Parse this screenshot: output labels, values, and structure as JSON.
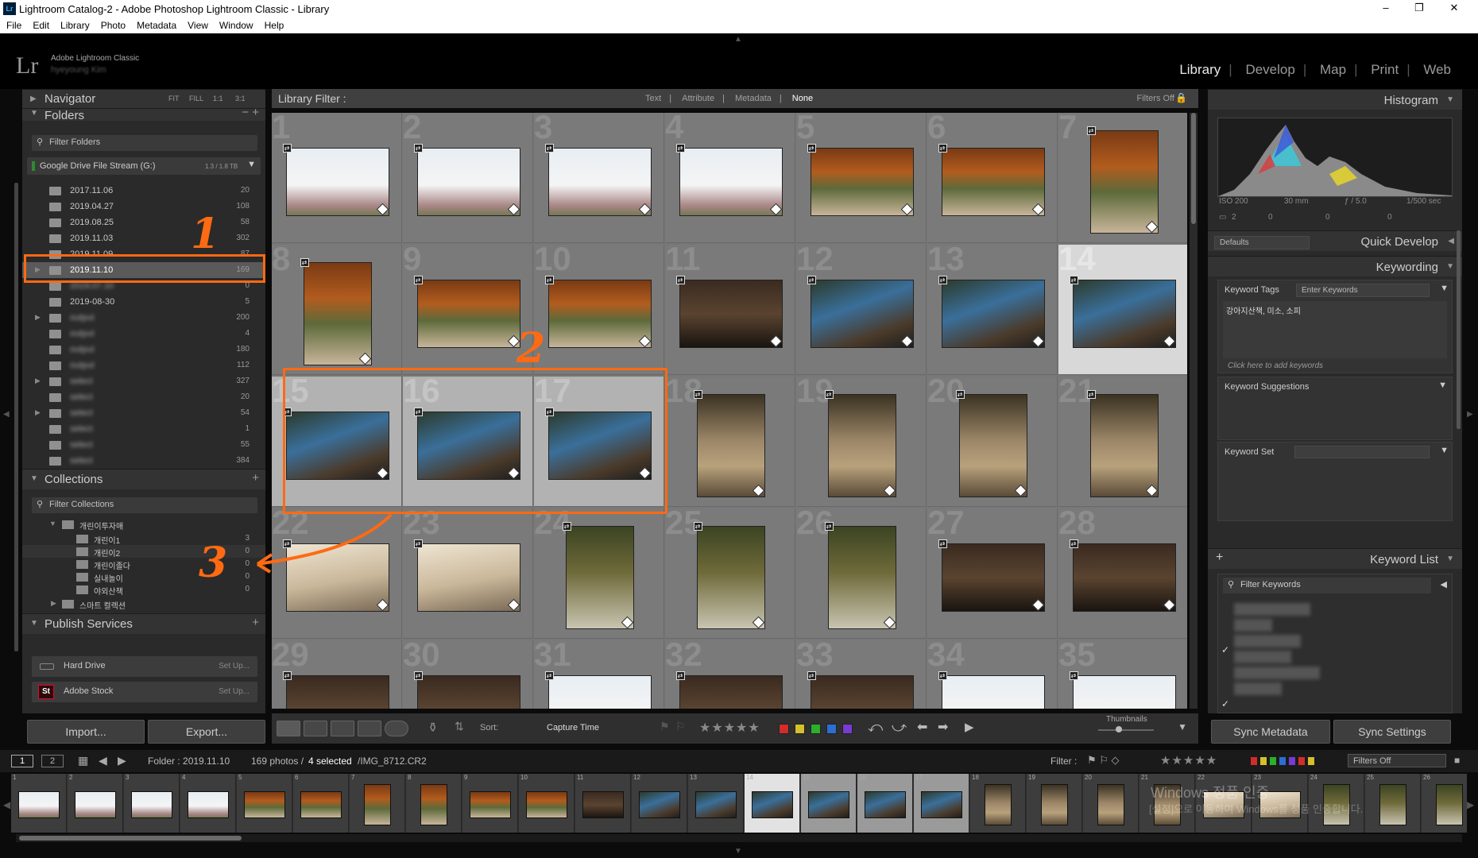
{
  "window": {
    "title": "Lightroom Catalog-2 - Adobe Photoshop Lightroom Classic - Library",
    "app_icon": "Lr",
    "min": "–",
    "max": "❐",
    "close": "✕"
  },
  "menu": [
    "File",
    "Edit",
    "Library",
    "Photo",
    "Metadata",
    "View",
    "Window",
    "Help"
  ],
  "identity": {
    "logo": "Lr",
    "product": "Adobe Lightroom Classic",
    "user": "hyeyoung Kim"
  },
  "modules": [
    "Library",
    "Develop",
    "Map",
    "Print",
    "Web"
  ],
  "active_module": "Library",
  "navigator": {
    "title": "Navigator",
    "zoom": [
      "FIT",
      "FILL",
      "1:1",
      "3:1"
    ]
  },
  "folders": {
    "title": "Folders",
    "filter": "Filter Folders",
    "volume": {
      "name": "Google Drive File Stream (G:)",
      "space": "1.3 / 1.8 TB"
    },
    "items": [
      {
        "name": "2017.11.06",
        "count": "20"
      },
      {
        "name": "2019.04.27",
        "count": "108"
      },
      {
        "name": "2019.08.25",
        "count": "58"
      },
      {
        "name": "2019.11.03",
        "count": "302"
      },
      {
        "name": "2019.11.09",
        "count": "87"
      },
      {
        "name": "2019.11.10",
        "count": "169"
      },
      {
        "name": "2019.07.10",
        "count": "0"
      },
      {
        "name": "2019-08-30",
        "count": "5"
      },
      {
        "name": "output",
        "count": "200"
      },
      {
        "name": "output",
        "count": "4"
      },
      {
        "name": "output",
        "count": "180"
      },
      {
        "name": "output",
        "count": "112"
      },
      {
        "name": "select",
        "count": "327"
      },
      {
        "name": "select",
        "count": "20"
      },
      {
        "name": "select",
        "count": "54"
      },
      {
        "name": "select",
        "count": "1"
      },
      {
        "name": "select",
        "count": "55"
      },
      {
        "name": "select",
        "count": "384"
      }
    ]
  },
  "collections": {
    "title": "Collections",
    "filter": "Filter Collections",
    "set": "개린이투자매",
    "items": [
      {
        "name": "개린이1",
        "count": "3"
      },
      {
        "name": "개린이2",
        "count": "0"
      },
      {
        "name": "개린이졸다",
        "count": "0"
      },
      {
        "name": "실내놀이",
        "count": "0"
      },
      {
        "name": "야외산책",
        "count": "0"
      }
    ],
    "smart": "스마트 컬렉션"
  },
  "publish": {
    "title": "Publish Services",
    "services": [
      {
        "name": "Hard Drive",
        "action": "Set Up..."
      },
      {
        "name": "Adobe Stock",
        "action": "Set Up..."
      }
    ]
  },
  "buttons": {
    "import": "Import...",
    "export": "Export...",
    "sync_metadata": "Sync Metadata",
    "sync_settings": "Sync Settings"
  },
  "library_filter": {
    "label": "Library Filter :",
    "options": [
      "Text",
      "Attribute",
      "Metadata",
      "None"
    ],
    "active": "None",
    "preset": "Filters Off"
  },
  "grid": {
    "cells": [
      {
        "n": "1",
        "kind": "sky",
        "o": "l"
      },
      {
        "n": "2",
        "kind": "sky",
        "o": "l"
      },
      {
        "n": "3",
        "kind": "sky",
        "o": "l"
      },
      {
        "n": "4",
        "kind": "sky",
        "o": "l"
      },
      {
        "n": "5",
        "kind": "tree",
        "o": "l"
      },
      {
        "n": "6",
        "kind": "tree",
        "o": "l"
      },
      {
        "n": "7",
        "kind": "tree",
        "o": "p"
      },
      {
        "n": "8",
        "kind": "tree",
        "o": "p"
      },
      {
        "n": "9",
        "kind": "tree",
        "o": "l"
      },
      {
        "n": "10",
        "kind": "tree",
        "o": "l"
      },
      {
        "n": "11",
        "kind": "dark",
        "o": "l"
      },
      {
        "n": "12",
        "kind": "pup",
        "o": "l"
      },
      {
        "n": "13",
        "kind": "pup",
        "o": "l"
      },
      {
        "n": "14",
        "kind": "pup",
        "o": "l",
        "state": "white"
      },
      {
        "n": "15",
        "kind": "pup",
        "o": "l",
        "state": "light"
      },
      {
        "n": "16",
        "kind": "pup",
        "o": "l",
        "state": "light"
      },
      {
        "n": "17",
        "kind": "pup",
        "o": "l",
        "state": "light"
      },
      {
        "n": "18",
        "kind": "road",
        "o": "p"
      },
      {
        "n": "19",
        "kind": "road",
        "o": "p"
      },
      {
        "n": "20",
        "kind": "road",
        "o": "p"
      },
      {
        "n": "21",
        "kind": "road",
        "o": "p"
      },
      {
        "n": "22",
        "kind": "sand",
        "o": "l"
      },
      {
        "n": "23",
        "kind": "sand",
        "o": "l"
      },
      {
        "n": "24",
        "kind": "green",
        "o": "p"
      },
      {
        "n": "25",
        "kind": "green",
        "o": "p"
      },
      {
        "n": "26",
        "kind": "green",
        "o": "p"
      },
      {
        "n": "27",
        "kind": "dark",
        "o": "l"
      },
      {
        "n": "28",
        "kind": "dark",
        "o": "l"
      },
      {
        "n": "29",
        "kind": "dark",
        "o": "l"
      },
      {
        "n": "30",
        "kind": "dark",
        "o": "l"
      },
      {
        "n": "31",
        "kind": "sky",
        "o": "l"
      },
      {
        "n": "32",
        "kind": "dark",
        "o": "l"
      },
      {
        "n": "33",
        "kind": "dark",
        "o": "l"
      },
      {
        "n": "34",
        "kind": "sky",
        "o": "l"
      },
      {
        "n": "35",
        "kind": "sky",
        "o": "l"
      }
    ]
  },
  "annotations": [
    "1",
    "2",
    "3"
  ],
  "toolbar": {
    "sort_label": "Sort:",
    "sort_value": "Capture Time",
    "thumbnails_label": "Thumbnails",
    "stars": "★★★★★",
    "colors": [
      "#d42b2b",
      "#d4c02b",
      "#2bb02b",
      "#2b6ed4",
      "#7a3ad4"
    ]
  },
  "histogram": {
    "title": "Histogram",
    "iso": "ISO 200",
    "focal": "30 mm",
    "aperture": "ƒ / 5.0",
    "shutter": "1/500 sec",
    "stat_a": "2",
    "stat_b": "0",
    "stat_c": "0",
    "stat_d": "0"
  },
  "quick_develop": {
    "title": "Quick Develop",
    "preset": "Defaults"
  },
  "keywording": {
    "title": "Keywording",
    "tags_label": "Keyword Tags",
    "tags_mode": "Enter Keywords",
    "tags_value": "강아지산책, 미소, 소피",
    "add_hint": "Click here to add keywords",
    "suggestions_title": "Keyword Suggestions",
    "set_label": "Keyword Set"
  },
  "keyword_list": {
    "title": "Keyword List",
    "filter": "Filter Keywords"
  },
  "filmstrip": {
    "folder": "Folder : 2019.11.10",
    "count": "169 photos /",
    "selected": "4 selected",
    "file": "/IMG_8712.CR2",
    "filter_label": "Filter :",
    "filter_preset": "Filters Off",
    "page1": "1",
    "page2": "2"
  },
  "watermark": {
    "line1": "Windows 정품 인증",
    "line2": "[설정]으로 이동하여 Windows를 정품 인증합니다."
  }
}
